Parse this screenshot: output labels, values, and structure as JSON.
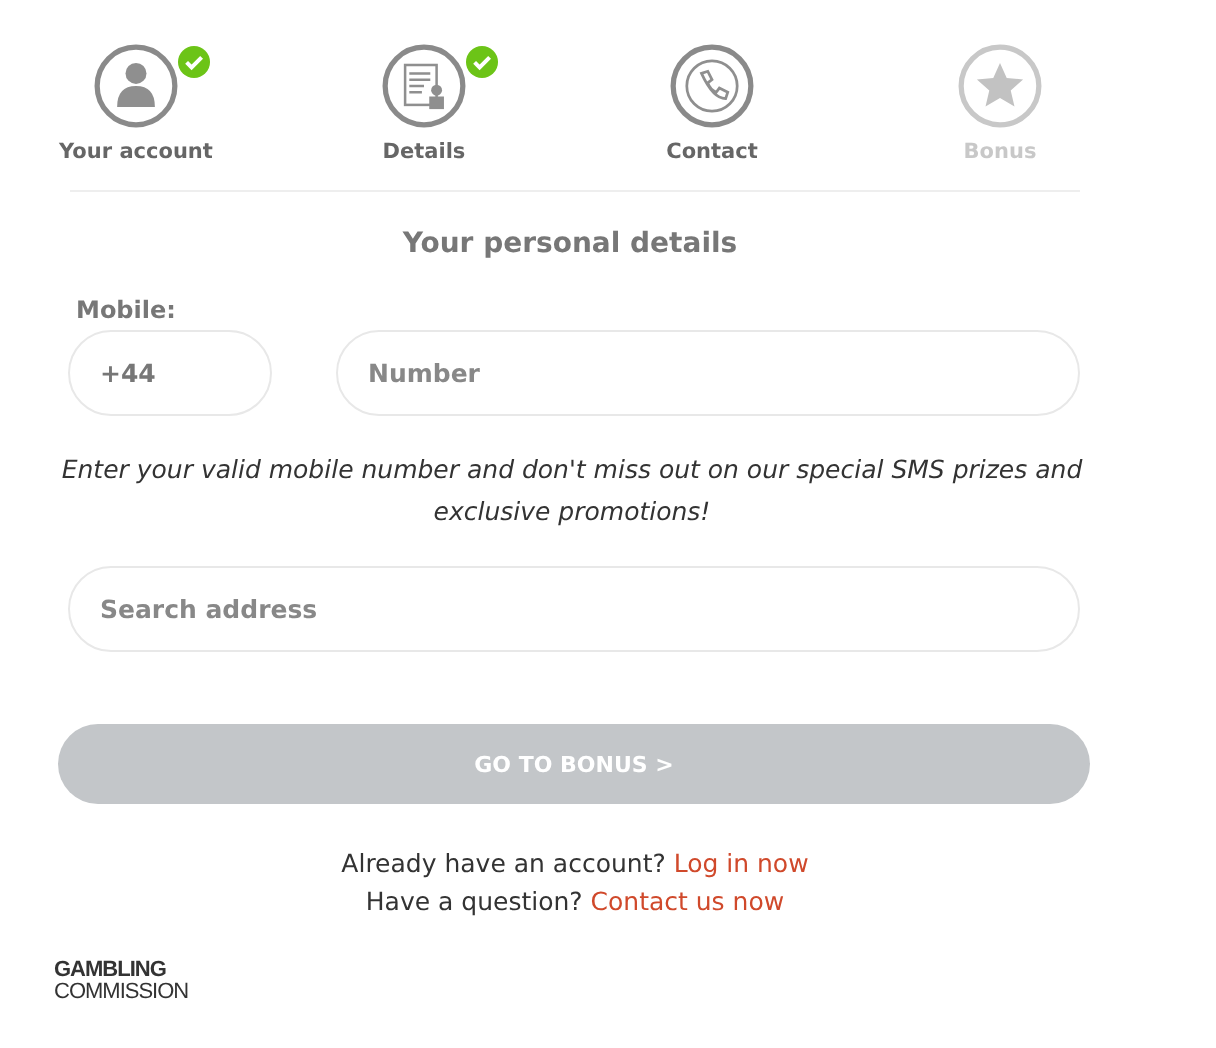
{
  "steps": [
    {
      "kind": "person",
      "label": "Your account",
      "completed": true,
      "disabled": false
    },
    {
      "kind": "document",
      "label": "Details",
      "completed": true,
      "disabled": false
    },
    {
      "kind": "phone",
      "label": "Contact",
      "completed": false,
      "disabled": false
    },
    {
      "kind": "star",
      "label": "Bonus",
      "completed": false,
      "disabled": true
    }
  ],
  "form": {
    "title": "Your personal details",
    "mobile_label": "Mobile:",
    "country_code": {
      "value": "+44"
    },
    "number": {
      "placeholder": "Number"
    },
    "hint": "Enter your valid mobile number and don't miss out on our special SMS prizes and exclusive promotions!",
    "address": {
      "placeholder": "Search address"
    },
    "submit": {
      "label": "GO TO BONUS >",
      "disabled": true
    }
  },
  "links": [
    {
      "text": "Already have an account?",
      "link": "Log in now"
    },
    {
      "text": "Have a question?",
      "link": "Contact us now"
    }
  ],
  "footer": {
    "logo_lines": [
      "GAMBLING",
      "COMMISSION"
    ]
  }
}
